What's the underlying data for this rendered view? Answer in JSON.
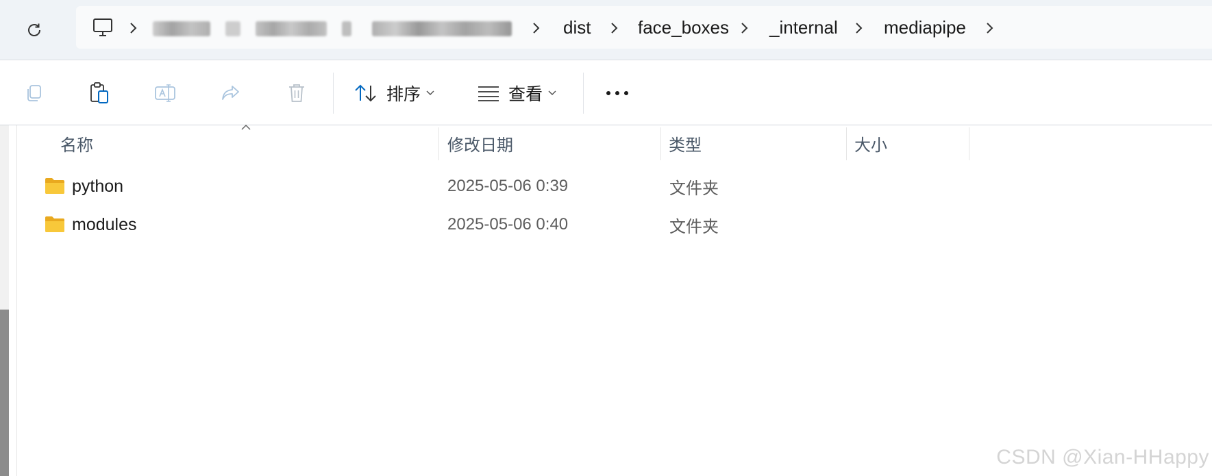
{
  "address_bar": {
    "breadcrumbs": [
      "dist",
      "face_boxes",
      "_internal",
      "mediapipe"
    ],
    "refresh_icon": "refresh-icon",
    "computer_icon": "this-pc-icon"
  },
  "toolbar": {
    "copy_icon": "copy-icon",
    "paste_icon": "paste-icon",
    "rename_icon": "rename-icon",
    "share_icon": "share-icon",
    "delete_icon": "trash-icon",
    "sort_label": "排序",
    "view_label": "查看",
    "more_icon": "more-horizontal-icon"
  },
  "columns": {
    "name": "名称",
    "modified": "修改日期",
    "type": "类型",
    "size": "大小"
  },
  "files": [
    {
      "name": "python",
      "modified": "2025-05-06 0:39",
      "type": "文件夹",
      "size": ""
    },
    {
      "name": "modules",
      "modified": "2025-05-06 0:40",
      "type": "文件夹",
      "size": ""
    }
  ],
  "watermark": "CSDN @Xian-HHappy",
  "colors": {
    "accent": "#0067c0",
    "folder": "#f8c83a",
    "address_bg": "#eff3f7"
  }
}
